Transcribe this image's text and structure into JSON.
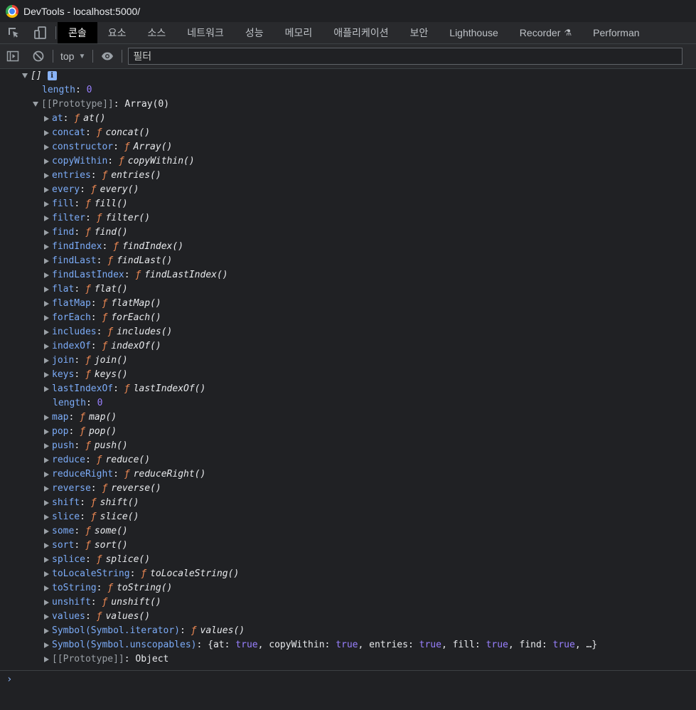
{
  "window": {
    "title": "DevTools - localhost:5000/"
  },
  "tabs": [
    {
      "label": "콘솔",
      "active": true
    },
    {
      "label": "요소"
    },
    {
      "label": "소스"
    },
    {
      "label": "네트워크"
    },
    {
      "label": "성능"
    },
    {
      "label": "메모리"
    },
    {
      "label": "애플리케이션"
    },
    {
      "label": "보안"
    },
    {
      "label": "Lighthouse"
    },
    {
      "label": "Recorder"
    },
    {
      "label": "Performan"
    }
  ],
  "toolbar": {
    "context": "top",
    "filter_placeholder": "필터"
  },
  "console": {
    "root_label": "[]",
    "length_key": "length",
    "length_value": "0",
    "proto_key": "[[Prototype]]",
    "proto_value": "Array(0)",
    "members": [
      {
        "key": "at",
        "fn": "at()"
      },
      {
        "key": "concat",
        "fn": "concat()"
      },
      {
        "key": "constructor",
        "fn": "Array()"
      },
      {
        "key": "copyWithin",
        "fn": "copyWithin()"
      },
      {
        "key": "entries",
        "fn": "entries()"
      },
      {
        "key": "every",
        "fn": "every()"
      },
      {
        "key": "fill",
        "fn": "fill()"
      },
      {
        "key": "filter",
        "fn": "filter()"
      },
      {
        "key": "find",
        "fn": "find()"
      },
      {
        "key": "findIndex",
        "fn": "findIndex()"
      },
      {
        "key": "findLast",
        "fn": "findLast()"
      },
      {
        "key": "findLastIndex",
        "fn": "findLastIndex()"
      },
      {
        "key": "flat",
        "fn": "flat()"
      },
      {
        "key": "flatMap",
        "fn": "flatMap()"
      },
      {
        "key": "forEach",
        "fn": "forEach()"
      },
      {
        "key": "includes",
        "fn": "includes()"
      },
      {
        "key": "indexOf",
        "fn": "indexOf()"
      },
      {
        "key": "join",
        "fn": "join()"
      },
      {
        "key": "keys",
        "fn": "keys()"
      },
      {
        "key": "lastIndexOf",
        "fn": "lastIndexOf()"
      },
      {
        "key": "length",
        "num": "0"
      },
      {
        "key": "map",
        "fn": "map()"
      },
      {
        "key": "pop",
        "fn": "pop()"
      },
      {
        "key": "push",
        "fn": "push()"
      },
      {
        "key": "reduce",
        "fn": "reduce()"
      },
      {
        "key": "reduceRight",
        "fn": "reduceRight()"
      },
      {
        "key": "reverse",
        "fn": "reverse()"
      },
      {
        "key": "shift",
        "fn": "shift()"
      },
      {
        "key": "slice",
        "fn": "slice()"
      },
      {
        "key": "some",
        "fn": "some()"
      },
      {
        "key": "sort",
        "fn": "sort()"
      },
      {
        "key": "splice",
        "fn": "splice()"
      },
      {
        "key": "toLocaleString",
        "fn": "toLocaleString()"
      },
      {
        "key": "toString",
        "fn": "toString()"
      },
      {
        "key": "unshift",
        "fn": "unshift()"
      },
      {
        "key": "values",
        "fn": "values()"
      },
      {
        "key": "Symbol(Symbol.iterator)",
        "fn": "values()"
      }
    ],
    "unscopables": {
      "key": "Symbol(Symbol.unscopables)",
      "pairs": [
        {
          "k": "at",
          "v": "true"
        },
        {
          "k": "copyWithin",
          "v": "true"
        },
        {
          "k": "entries",
          "v": "true"
        },
        {
          "k": "fill",
          "v": "true"
        },
        {
          "k": "find",
          "v": "true"
        }
      ],
      "ellipsis": "…"
    },
    "inner_proto_key": "[[Prototype]]",
    "inner_proto_value": "Object",
    "function_symbol": "ƒ"
  },
  "prompt": {
    "symbol": "›"
  }
}
